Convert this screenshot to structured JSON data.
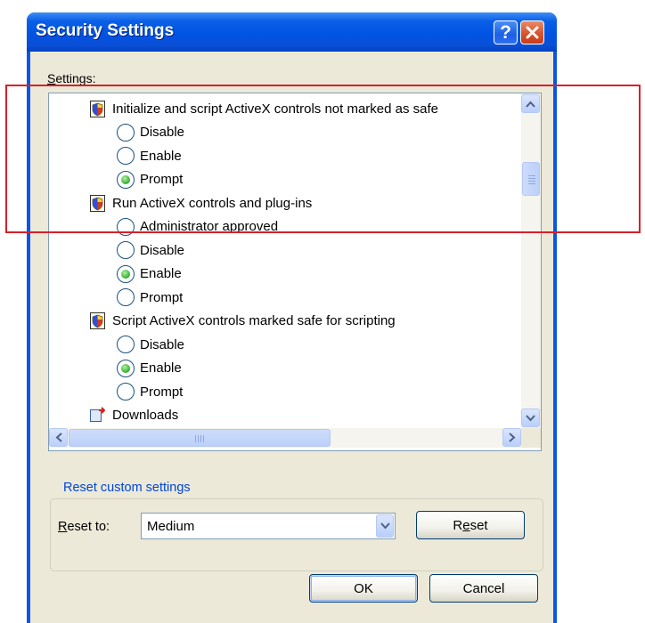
{
  "window": {
    "title": "Security Settings",
    "help_label": "?",
    "close_label": "✕"
  },
  "settings": {
    "label_first": "S",
    "label_rest": "ettings:",
    "rows": [
      {
        "kind": "category",
        "label": "Initialize and script ActiveX controls not marked as safe"
      },
      {
        "kind": "option",
        "label": "Disable",
        "selected": false
      },
      {
        "kind": "option",
        "label": "Enable",
        "selected": false
      },
      {
        "kind": "option",
        "label": "Prompt",
        "selected": true
      },
      {
        "kind": "category",
        "label": "Run ActiveX controls and plug-ins"
      },
      {
        "kind": "option",
        "label": "Administrator approved",
        "selected": false
      },
      {
        "kind": "option",
        "label": "Disable",
        "selected": false
      },
      {
        "kind": "option",
        "label": "Enable",
        "selected": true
      },
      {
        "kind": "option",
        "label": "Prompt",
        "selected": false
      },
      {
        "kind": "category",
        "label": "Script ActiveX controls marked safe for scripting"
      },
      {
        "kind": "option",
        "label": "Disable",
        "selected": false
      },
      {
        "kind": "option",
        "label": "Enable",
        "selected": true
      },
      {
        "kind": "option",
        "label": "Prompt",
        "selected": false
      },
      {
        "kind": "category",
        "label": "Downloads"
      }
    ]
  },
  "reset_group": {
    "title": "Reset custom settings",
    "reset_to_label_first": "R",
    "reset_to_label_rest": "eset to:",
    "selected_level": "Medium",
    "reset_label_first": "R",
    "reset_label_mid": "e",
    "reset_label_rest": "set"
  },
  "footer": {
    "ok_label": "OK",
    "cancel_label": "Cancel"
  },
  "colors": {
    "title_bar": "#0054e3",
    "dialog_face": "#ece9d8",
    "group_title": "#0046d5",
    "radio_selected": "#2fae2f",
    "annotation": "#d8202a"
  },
  "icons": {
    "category": "security-zone-icon",
    "downloads": "download-icon"
  }
}
